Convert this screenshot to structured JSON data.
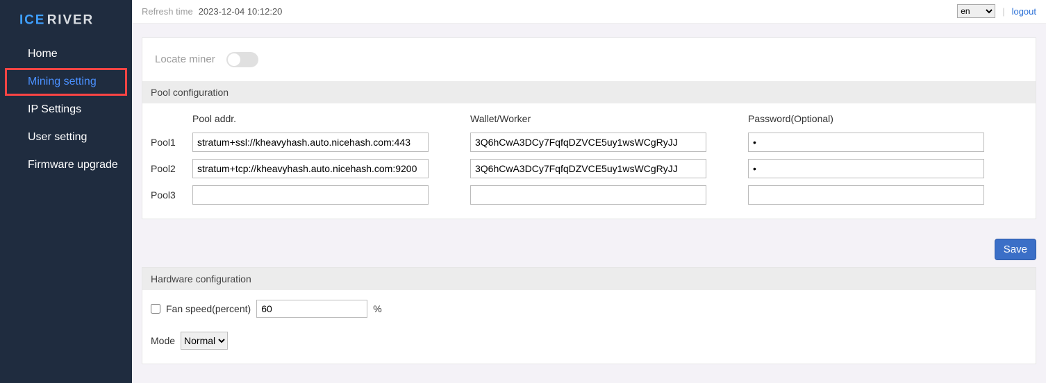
{
  "brand": {
    "part1": "ICE",
    "part2": "RIVER"
  },
  "sidebar": {
    "items": [
      {
        "label": "Home"
      },
      {
        "label": "Mining setting"
      },
      {
        "label": "IP Settings"
      },
      {
        "label": "User setting"
      },
      {
        "label": "Firmware upgrade"
      }
    ],
    "activeIndex": 1
  },
  "topbar": {
    "refresh_label": "Refresh time",
    "refresh_time": "2023-12-04 10:12:20",
    "lang_selected": "en",
    "logout": "logout"
  },
  "locate": {
    "label": "Locate miner",
    "on": false
  },
  "pool": {
    "section_title": "Pool configuration",
    "headers": {
      "addr": "Pool addr.",
      "wallet": "Wallet/Worker",
      "password": "Password(Optional)"
    },
    "rows": [
      {
        "label": "Pool1",
        "addr": "stratum+ssl://kheavyhash.auto.nicehash.com:443",
        "wallet": "3Q6hCwA3DCy7FqfqDZVCE5uy1wsWCgRyJJ",
        "password": "x"
      },
      {
        "label": "Pool2",
        "addr": "stratum+tcp://kheavyhash.auto.nicehash.com:9200",
        "wallet": "3Q6hCwA3DCy7FqfqDZVCE5uy1wsWCgRyJJ",
        "password": "x"
      },
      {
        "label": "Pool3",
        "addr": "",
        "wallet": "",
        "password": ""
      }
    ]
  },
  "save_label": "Save",
  "hardware": {
    "section_title": "Hardware configuration",
    "fan_label": "Fan speed(percent)",
    "fan_value": "60",
    "fan_unit": "%",
    "mode_label": "Mode",
    "mode_selected": "Normal",
    "mode_options": [
      "Normal"
    ]
  }
}
